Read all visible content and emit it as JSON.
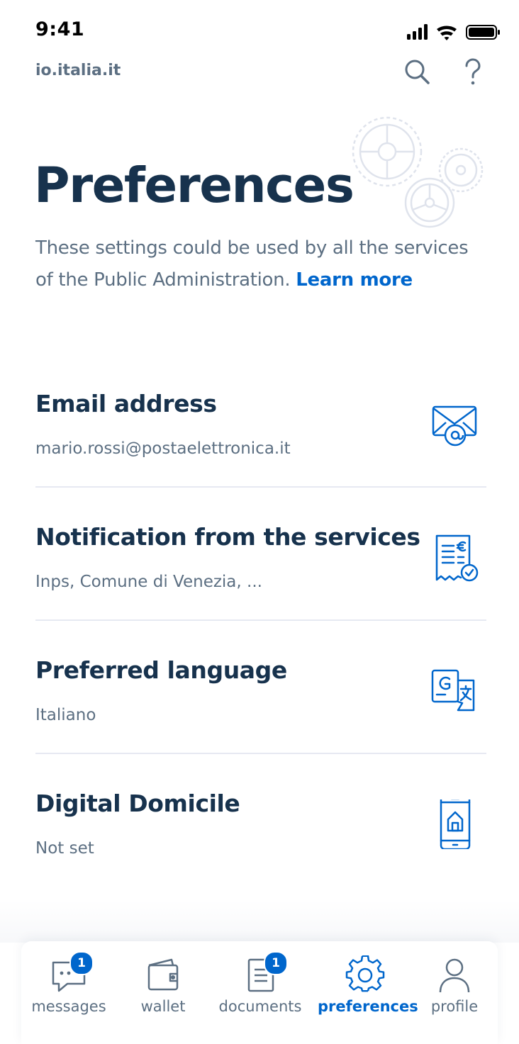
{
  "status_bar": {
    "time": "9:41"
  },
  "header": {
    "domain": "io.italia.it",
    "search_icon": "search-icon",
    "help_icon": "help-icon"
  },
  "page": {
    "title": "Preferences",
    "description": "These settings could be used by all the services of the Public Administration.",
    "learn_more": "Learn more"
  },
  "preferences": [
    {
      "title": "Email address",
      "value": "mario.rossi@postaelettronica.it",
      "icon": "email-icon"
    },
    {
      "title": "Notification from the services",
      "value": "Inps, Comune di Venezia, ...",
      "icon": "receipt-check-icon"
    },
    {
      "title": "Preferred language",
      "value": "Italiano",
      "icon": "translate-icon"
    },
    {
      "title": "Digital Domicile",
      "value": "Not set",
      "icon": "smartphone-home-icon"
    }
  ],
  "tabs": [
    {
      "label": "messages",
      "badge": "1",
      "icon": "chat-bubble-icon",
      "active": false
    },
    {
      "label": "wallet",
      "badge": "",
      "icon": "wallet-icon",
      "active": false
    },
    {
      "label": "documents",
      "badge": "1",
      "icon": "document-icon",
      "active": false
    },
    {
      "label": "preferences",
      "badge": "",
      "icon": "gear-icon",
      "active": true
    },
    {
      "label": "profile",
      "badge": "",
      "icon": "user-icon",
      "active": false
    }
  ],
  "colors": {
    "primary": "#0066cc",
    "title": "#17324d",
    "text": "#5c6f82",
    "divider": "#e6e9f2"
  }
}
